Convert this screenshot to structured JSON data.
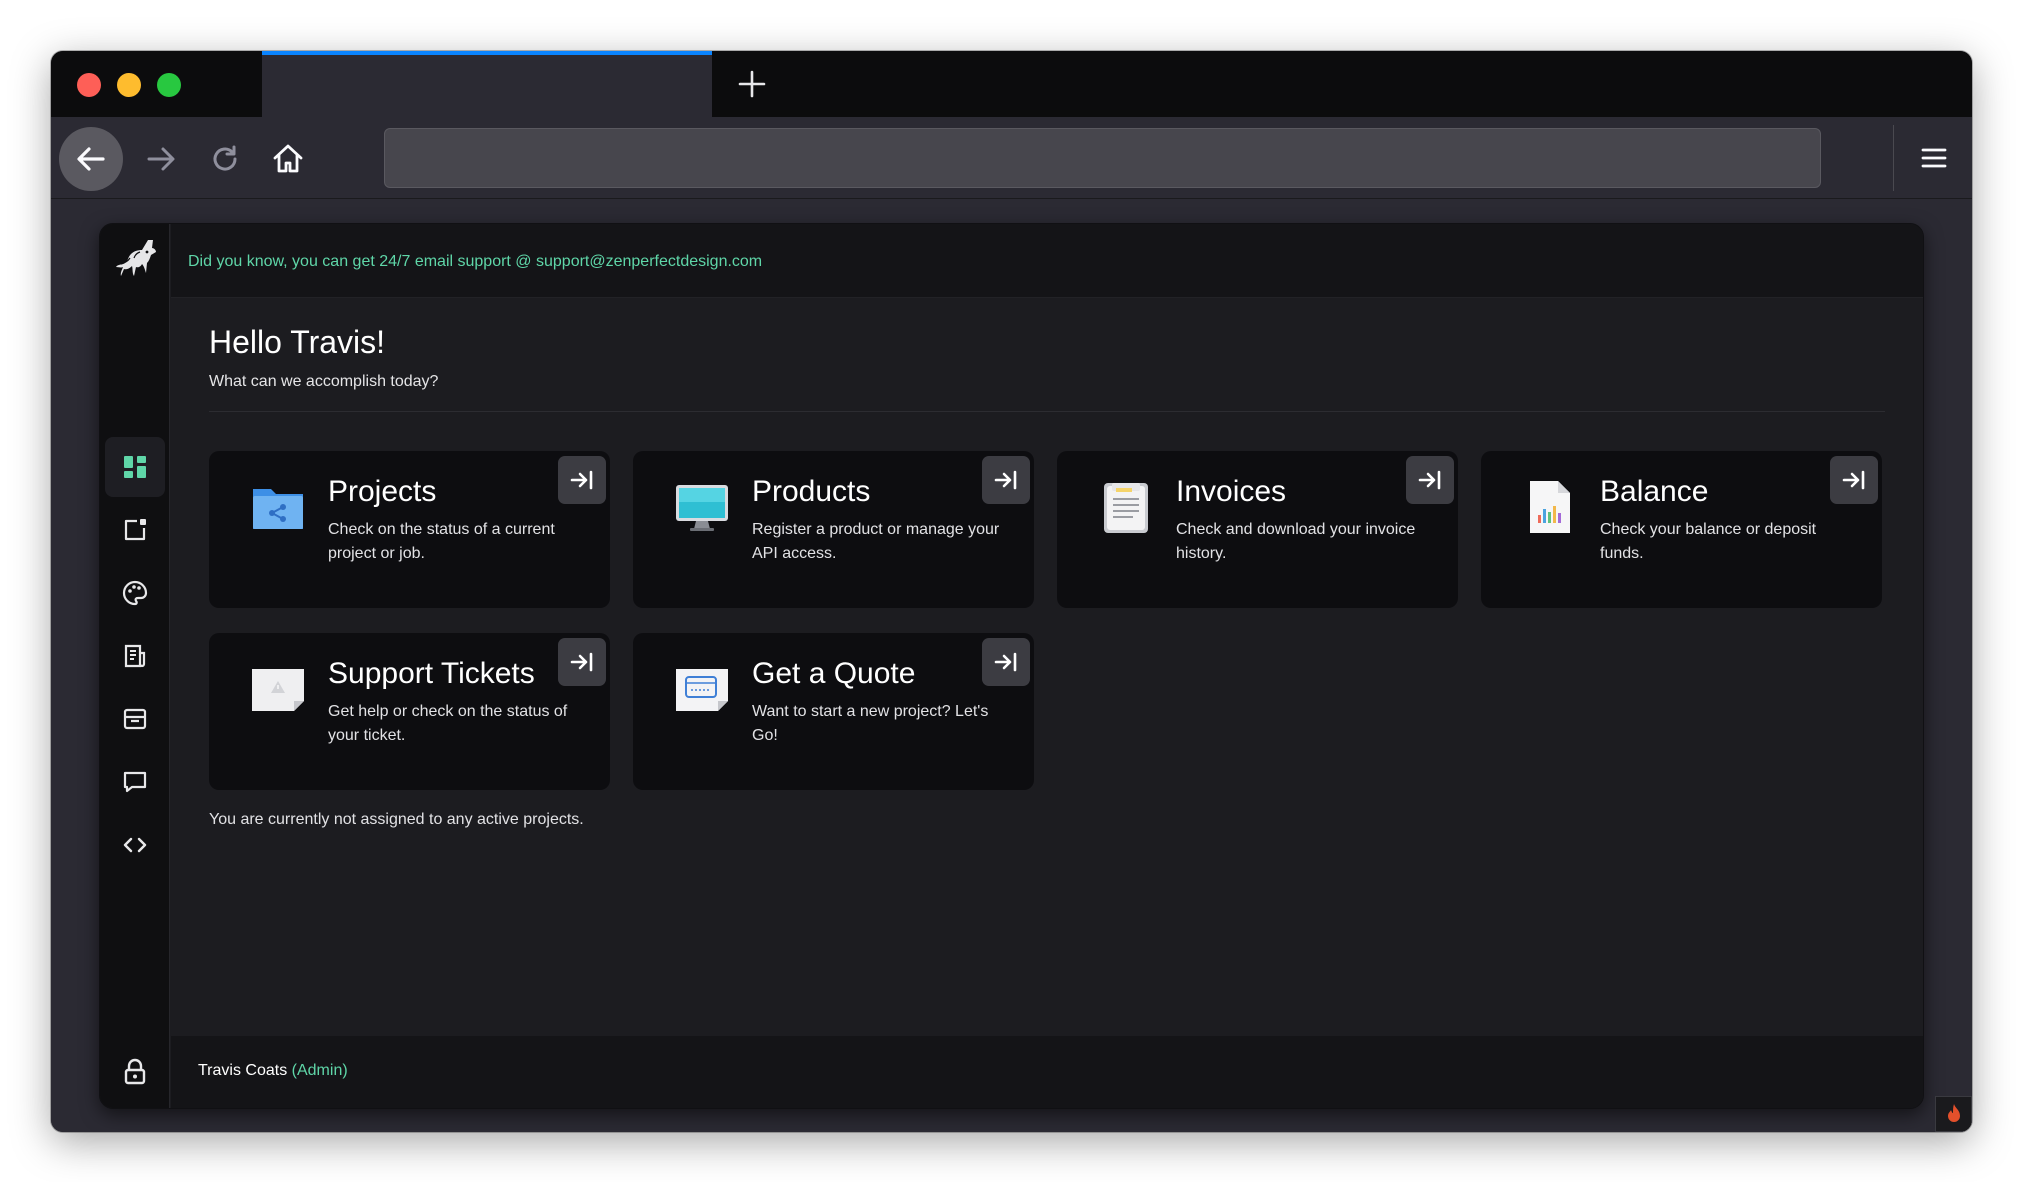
{
  "browser": {
    "url": "",
    "colors": {
      "tab_accent": "#0a84ff",
      "traffic_red": "#fe5f57",
      "traffic_yellow": "#febc2e",
      "traffic_green": "#28c840"
    },
    "icons": [
      "new-tab-icon",
      "back-arrow-icon",
      "forward-arrow-icon",
      "reload-icon",
      "home-icon",
      "hamburger-menu-icon"
    ]
  },
  "topbar": {
    "tip": "Did you know, you can get 24/7 email support @ support@zenperfectdesign.com"
  },
  "sidebar": {
    "items": [
      {
        "icon": "dashboard-icon",
        "active": true
      },
      {
        "icon": "new-project-icon"
      },
      {
        "icon": "palette-icon"
      },
      {
        "icon": "invoice-list-icon"
      },
      {
        "icon": "archive-box-icon"
      },
      {
        "icon": "chat-bubble-icon"
      },
      {
        "icon": "code-brackets-icon"
      }
    ],
    "bottom_icon": "lock-icon"
  },
  "main": {
    "greeting": "Hello Travis!",
    "subgreeting": "What can we accomplish today?",
    "cards": [
      {
        "title": "Projects",
        "desc": "Check on the status of a current project or job.",
        "icon": "folder-share-icon"
      },
      {
        "title": "Products",
        "desc": "Register a product or manage your API access.",
        "icon": "monitor-icon"
      },
      {
        "title": "Invoices",
        "desc": "Check and download your invoice history.",
        "icon": "invoice-document-icon"
      },
      {
        "title": "Balance",
        "desc": "Check your balance or deposit funds.",
        "icon": "chart-document-icon"
      },
      {
        "title": "Support Tickets",
        "desc": "Get help or check on the status of your ticket.",
        "icon": "warning-note-icon"
      },
      {
        "title": "Get a Quote",
        "desc": "Want to start a new project? Let's Go!",
        "icon": "quote-form-icon"
      }
    ],
    "status": "You are currently not assigned to any active projects."
  },
  "footer": {
    "user_name": "Travis Coats",
    "user_role": "(Admin)"
  },
  "theme": {
    "accent": "#5fd6a8",
    "background": "#1c1c20"
  }
}
